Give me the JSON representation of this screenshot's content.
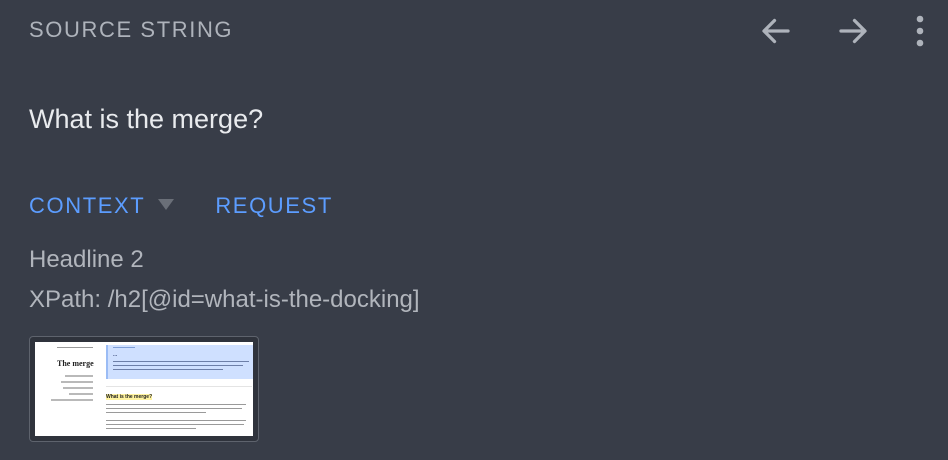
{
  "header": {
    "label": "SOURCE STRING",
    "back_icon": "arrow-left-icon",
    "forward_icon": "arrow-right-icon",
    "more_icon": "more-vertical-icon",
    "icon_color": "#aeb3bb"
  },
  "source": {
    "text": "What is the merge?"
  },
  "tabs": [
    {
      "label": "CONTEXT",
      "has_dropdown": true
    },
    {
      "label": "REQUEST"
    }
  ],
  "tab_color": "#5c9dff",
  "context": {
    "element_type": "Headline 2",
    "xpath": "XPath: /h2[@id=what-is-the-docking]"
  },
  "screenshot_thumbnail": {
    "page_title": "The merge",
    "callout_title": "...",
    "section_heading": "What is the merge?"
  }
}
